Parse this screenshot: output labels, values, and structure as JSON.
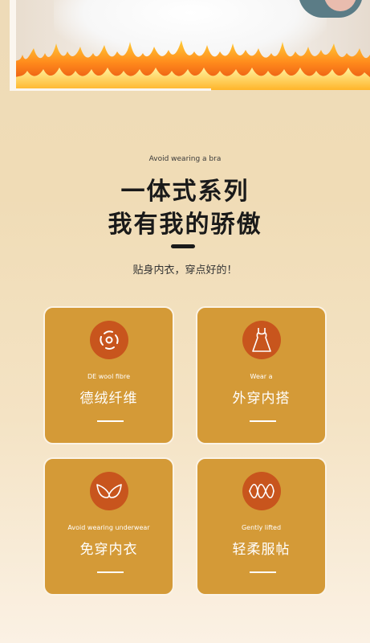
{
  "header": {
    "eyebrow": "Avoid wearing a bra",
    "title_line1": "一体式系列",
    "title_line2": "我有我的骄傲",
    "slogan": "贴身内衣，穿点好的！"
  },
  "colors": {
    "card_bg": "#d49a37",
    "badge_bg": "#c8551d",
    "text_dark": "#1a1a1a"
  },
  "features": [
    {
      "en": "DE wool fibre",
      "cn": "德绒纤维",
      "icon": "fiber-cycle-icon"
    },
    {
      "en": "Wear a",
      "cn": "外穿内搭",
      "icon": "dress-icon"
    },
    {
      "en": "Avoid wearing underwear",
      "cn": "免穿内衣",
      "icon": "bra-icon"
    },
    {
      "en": "Gently lifted",
      "cn": "轻柔服帖",
      "icon": "wave-lift-icon"
    }
  ]
}
